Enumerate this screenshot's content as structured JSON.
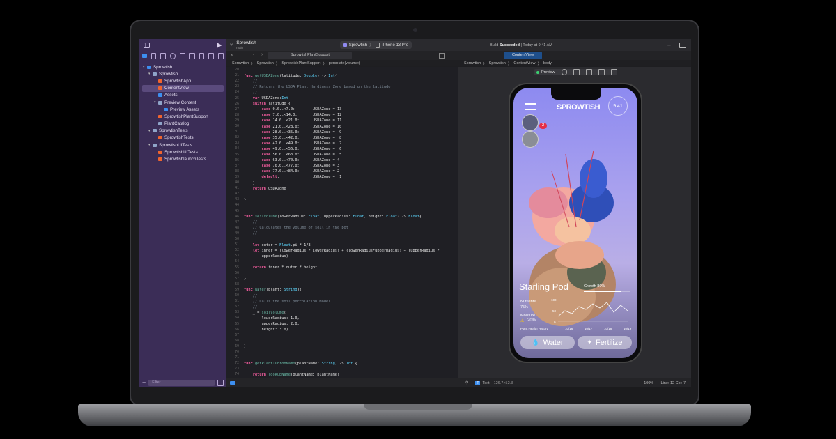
{
  "project": {
    "name": "Sprowtish",
    "branch": "main"
  },
  "scheme": {
    "name": "Sprowtish",
    "device": "iPhone 13 Pro"
  },
  "build_status": {
    "prefix": "Build",
    "status": "Succeeded",
    "time": "| Today at 9:41 AM"
  },
  "navigator": {
    "items": [
      {
        "label": "Sprowtish",
        "indent": 0,
        "kind": "xc",
        "chev": "▾"
      },
      {
        "label": "Sprowtish",
        "indent": 1,
        "kind": "folder",
        "chev": "▾"
      },
      {
        "label": "SprowtishApp",
        "indent": 2,
        "kind": "swift",
        "chev": ""
      },
      {
        "label": "ContentView",
        "indent": 2,
        "kind": "swift",
        "chev": "",
        "selected": true
      },
      {
        "label": "Assets",
        "indent": 2,
        "kind": "xc",
        "chev": ""
      },
      {
        "label": "Preview Content",
        "indent": 2,
        "kind": "folder",
        "chev": "▾"
      },
      {
        "label": "Preview Assets",
        "indent": 3,
        "kind": "xc",
        "chev": ""
      },
      {
        "label": "SprowtishPlantSupport",
        "indent": 2,
        "kind": "swift",
        "chev": ""
      },
      {
        "label": "PlantCatalog",
        "indent": 2,
        "kind": "folder",
        "chev": ""
      },
      {
        "label": "SprowtishTests",
        "indent": 1,
        "kind": "folder",
        "chev": "▾"
      },
      {
        "label": "SprowtishTests",
        "indent": 2,
        "kind": "swift",
        "chev": ""
      },
      {
        "label": "SprowtishUITests",
        "indent": 1,
        "kind": "folder",
        "chev": "▾"
      },
      {
        "label": "SprowtishUITests",
        "indent": 2,
        "kind": "swift",
        "chev": ""
      },
      {
        "label": "SprowtishlaunchTests",
        "indent": 2,
        "kind": "swift",
        "chev": ""
      }
    ],
    "filter_placeholder": "Filter"
  },
  "editor": {
    "tab": "SprowtishPlantSupport",
    "breadcrumbs": [
      "Sprowtish",
      "Sprowtish",
      "SprowtishPlantSupport",
      "percolate(volume:)"
    ],
    "line_numbers": [
      "20",
      "21",
      "22",
      "23",
      "24",
      "25",
      "26",
      "27",
      "28",
      "29",
      "30",
      "31",
      "32",
      "33",
      "34",
      "35",
      "36",
      "37",
      "38",
      "39",
      "40",
      "41",
      "42",
      "43",
      "44",
      "45",
      "46",
      "47",
      "48",
      "49",
      "50",
      "51",
      "52",
      "53",
      "54",
      "55",
      "56",
      "57",
      "58",
      "59",
      "60",
      "61",
      "62",
      "63",
      "64",
      "65",
      "66",
      "67",
      "68",
      "69",
      "70",
      "71",
      "72",
      "73",
      "74"
    ]
  },
  "code_lines": [
    "",
    "func getUSDAZone(latitude: Double) -> Int{",
    "    //",
    "    // Returns the USDA Plant Hardiness Zone based on the latitude",
    "    //",
    "    var USDAZone:Int",
    "    switch latitude {",
    "        case 0.0..<7.0:        USDAZone = 13",
    "        case 7.0..<14.0:       USDAZone = 12",
    "        case 14.0..<21.0:      USDAZone = 11",
    "        case 21.0..<28.0:      USDAZone = 10",
    "        case 28.0..<35.0:      USDAZone =  9",
    "        case 35.0..<42.0:      USDAZone =  8",
    "        case 42.0..<49.0:      USDAZone =  7",
    "        case 49.0..<56.0:      USDAZone =  6",
    "        case 56.0..<63.0:      USDAZone =  5",
    "        case 63.0..<70.0:      USDAZone = 4",
    "        case 70.0..<77.0:      USDAZone = 3",
    "        case 77.0..<84.0:      USDAZone = 2",
    "        default:               USDAZone =  1",
    "    }",
    "    return USDAZone",
    "",
    "}",
    "",
    "",
    "func soilVolume(lowerRadius: Float, upperRadius: Float, height: Float) -> Float{",
    "    //",
    "    // Calculates the volume of soil in the pot",
    "    //",
    "",
    "    let outer = Float.pi * 1/3",
    "    let inner = (lowerRadius * lowerRadius) + (lowerRadius*upperRadius) + (upperRadius *",
    "        upperRadius)",
    "",
    "    return inner * outer * height",
    "",
    "}",
    "",
    "func water(plant: String){",
    "    //",
    "    // Calls the soil percolation model",
    "    //",
    "    _ = soilVolume(",
    "        lowerRadius: 1.0,",
    "        upperRadius: 2.0,",
    "        height: 3.0)",
    "",
    "",
    "}",
    "",
    "",
    "func getPlantIDFromName(plantName: String) -> Int {",
    "",
    "    return lookupName(plantName: plantName)",
    "",
    "}",
    ""
  ],
  "canvas": {
    "tab": "ContentView",
    "breadcrumbs": [
      "Sprowtish",
      "Sprowtish",
      "ContentView",
      "body"
    ],
    "preview_label": "Preview",
    "zoom": "100%"
  },
  "status_bar": {
    "element": "Text",
    "size": "126.7×52.3",
    "position": "Line: 12  Col: 7"
  },
  "app": {
    "logo": "SPROWTISH",
    "time": "9:41",
    "badge": "2",
    "plant_name": "Starling Pod",
    "growth_label": "Growth 80%",
    "growth": 0.8,
    "nutrients_label": "Nutrients",
    "nutrients_value": "75%",
    "moisture_label": "Moisture",
    "moisture_value": "20%",
    "chart_y": [
      "100",
      "50",
      "0"
    ],
    "chart_x": [
      "10/16",
      "10/17",
      "10/18",
      "10/19"
    ],
    "history_label": "Plant Health History",
    "water_button": "Water",
    "fertilize_button": "Fertilize"
  },
  "colors": {
    "sidebar": "#3b2d57",
    "accent": "#3d8ff0",
    "swift": "#f0642e"
  }
}
